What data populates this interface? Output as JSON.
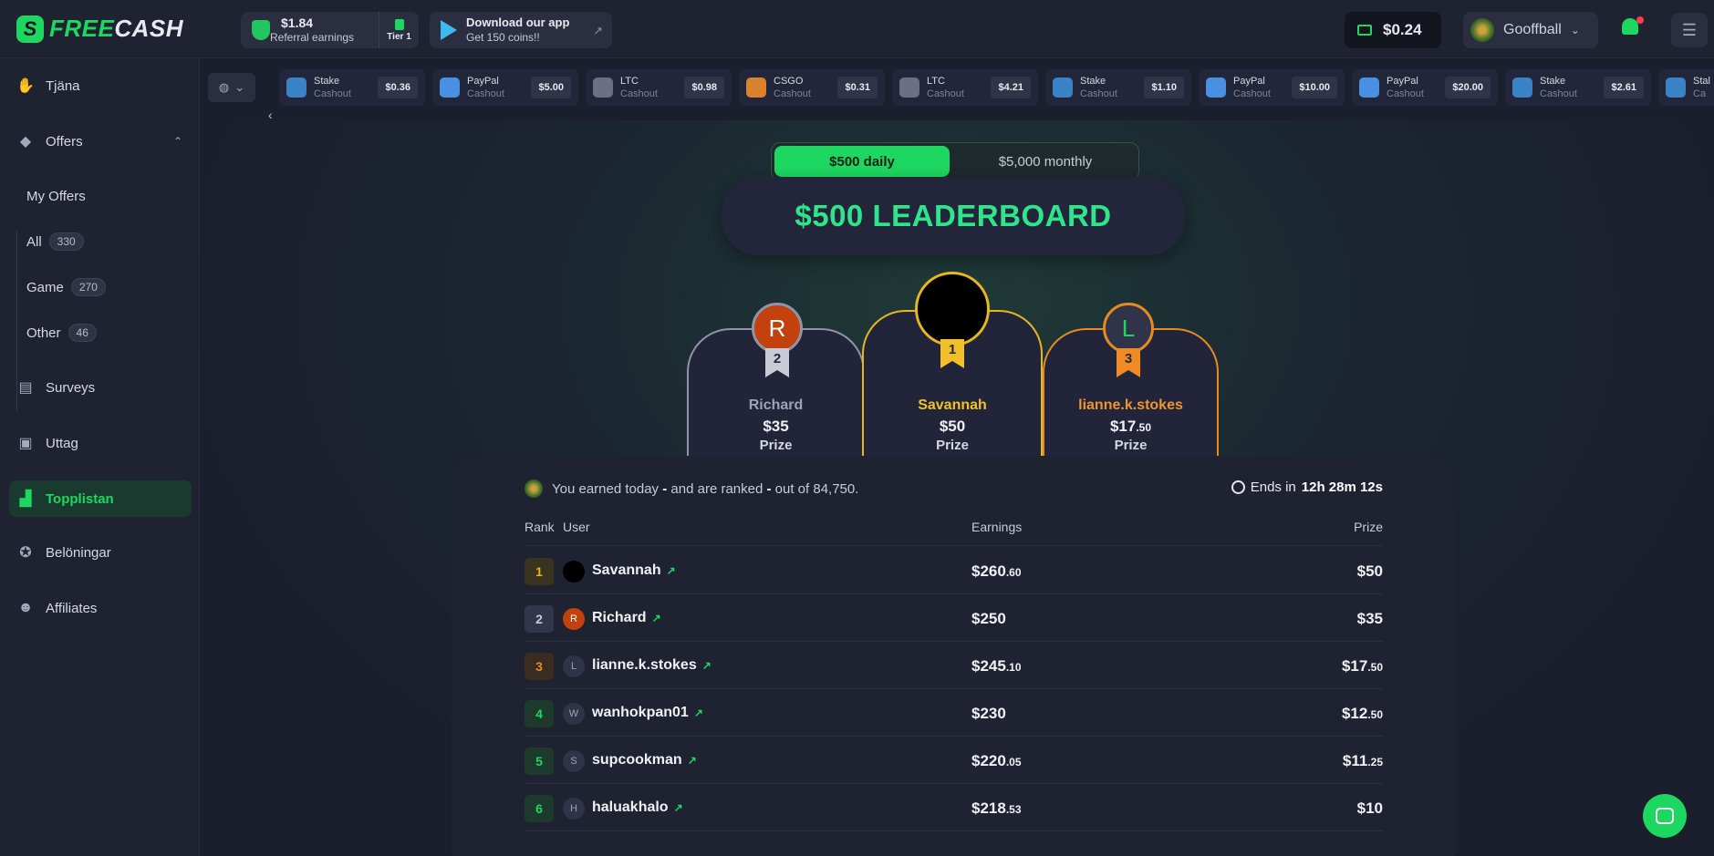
{
  "brand": {
    "logo_mark": "S",
    "name_green": "FREE",
    "name_white": "CASH"
  },
  "header": {
    "referral": {
      "amount": "$1.84",
      "label": "Referral earnings",
      "tier": "Tier 1"
    },
    "app_promo": {
      "title": "Download our app",
      "subtitle": "Get 150 coins!!"
    },
    "balance": "$0.24",
    "username": "Gooffball"
  },
  "sidebar": {
    "items": [
      {
        "label": "Tjäna",
        "icon": "earn-icon"
      },
      {
        "label": "Offers",
        "icon": "tag-icon"
      },
      {
        "label": "Surveys",
        "icon": "clipboard-icon"
      },
      {
        "label": "Uttag",
        "icon": "wallet-icon"
      },
      {
        "label": "Topplistan",
        "icon": "leaderboard-icon"
      },
      {
        "label": "Belöningar",
        "icon": "award-icon"
      },
      {
        "label": "Affiliates",
        "icon": "users-icon"
      }
    ],
    "offers_sub": [
      {
        "label": "My Offers",
        "count": ""
      },
      {
        "label": "All",
        "count": "330"
      },
      {
        "label": "Game",
        "count": "270"
      },
      {
        "label": "Other",
        "count": "46"
      }
    ]
  },
  "ticker": [
    {
      "name": "Stake",
      "type": "Cashout",
      "amount": "$0.36",
      "color": "#3b82c4"
    },
    {
      "name": "PayPal",
      "type": "Cashout",
      "amount": "$5.00",
      "color": "#4a90e2"
    },
    {
      "name": "LTC",
      "type": "Cashout",
      "amount": "$0.98",
      "color": "#6b7087"
    },
    {
      "name": "CSGO",
      "type": "Cashout",
      "amount": "$0.31",
      "color": "#d9822b"
    },
    {
      "name": "LTC",
      "type": "Cashout",
      "amount": "$4.21",
      "color": "#6b7087"
    },
    {
      "name": "Stake",
      "type": "Cashout",
      "amount": "$1.10",
      "color": "#3b82c4"
    },
    {
      "name": "PayPal",
      "type": "Cashout",
      "amount": "$10.00",
      "color": "#4a90e2"
    },
    {
      "name": "PayPal",
      "type": "Cashout",
      "amount": "$20.00",
      "color": "#4a90e2"
    },
    {
      "name": "Stake",
      "type": "Cashout",
      "amount": "$2.61",
      "color": "#3b82c4"
    },
    {
      "name": "Stal",
      "type": "Ca",
      "amount": "",
      "color": "#3b82c4"
    }
  ],
  "leaderboard": {
    "tabs": {
      "daily": "$500 daily",
      "monthly": "$5,000 monthly"
    },
    "title": "$500 LEADERBOARD",
    "podium": [
      {
        "rank": "2",
        "initial": "R",
        "name": "Richard",
        "prize_main": "$35",
        "prize_cents": "",
        "label": "Prize"
      },
      {
        "rank": "1",
        "initial": "",
        "name": "Savannah",
        "prize_main": "$50",
        "prize_cents": "",
        "label": "Prize"
      },
      {
        "rank": "3",
        "initial": "L",
        "name": "lianne.k.stokes",
        "prize_main": "$17",
        "prize_cents": ".50",
        "label": "Prize"
      }
    ],
    "info": {
      "p1": "You earned today",
      "p2": "-",
      "p3": "and are ranked",
      "p4": "-",
      "p5": "out of 84,750."
    },
    "ends": {
      "label": "Ends in",
      "time": "12h 28m 12s"
    },
    "columns": {
      "rank": "Rank",
      "user": "User",
      "earnings": "Earnings",
      "prize": "Prize"
    },
    "rows": [
      {
        "rank": "1",
        "initial": "",
        "user": "Savannah",
        "earn_main": "$260",
        "earn_cents": ".60",
        "prize_main": "$50",
        "prize_cents": ""
      },
      {
        "rank": "2",
        "initial": "R",
        "user": "Richard",
        "earn_main": "$250",
        "earn_cents": "",
        "prize_main": "$35",
        "prize_cents": ""
      },
      {
        "rank": "3",
        "initial": "L",
        "user": "lianne.k.stokes",
        "earn_main": "$245",
        "earn_cents": ".10",
        "prize_main": "$17",
        "prize_cents": ".50"
      },
      {
        "rank": "4",
        "initial": "W",
        "user": "wanhokpan01",
        "earn_main": "$230",
        "earn_cents": "",
        "prize_main": "$12",
        "prize_cents": ".50"
      },
      {
        "rank": "5",
        "initial": "S",
        "user": "supcookman",
        "earn_main": "$220",
        "earn_cents": ".05",
        "prize_main": "$11",
        "prize_cents": ".25"
      },
      {
        "rank": "6",
        "initial": "H",
        "user": "haluakhalo",
        "earn_main": "$218",
        "earn_cents": ".53",
        "prize_main": "$10",
        "prize_cents": ""
      }
    ]
  }
}
